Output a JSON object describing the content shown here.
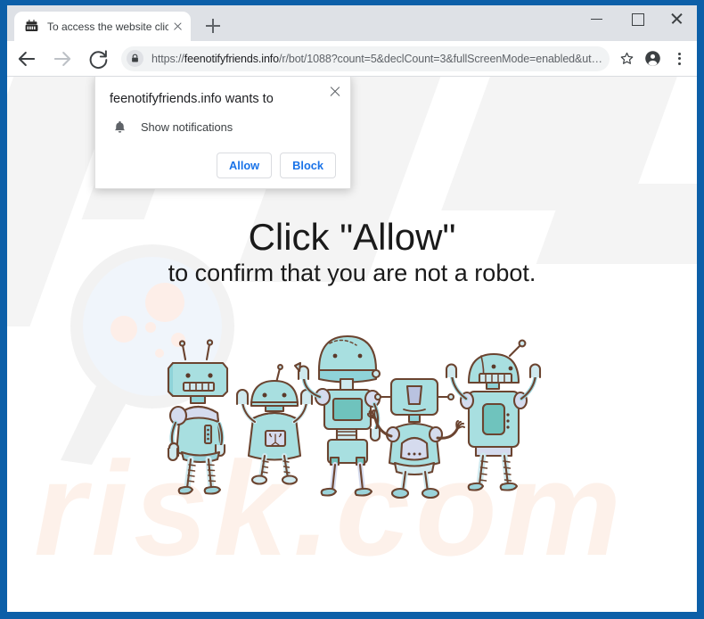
{
  "window": {
    "frame_color": "#0c5fa8",
    "controls": {
      "minimize": "minimize-button",
      "maximize": "maximize-button",
      "close": "close-button"
    }
  },
  "tabstrip": {
    "tab": {
      "title": "To access the website click the \"A",
      "favicon": "robot-head-icon",
      "close_label": "close-tab-icon"
    },
    "new_tab_label": "new-tab-button"
  },
  "toolbar": {
    "back": "back-icon",
    "forward": "forward-icon",
    "reload": "reload-icon",
    "lock": "lock-icon",
    "url_scheme": "https://",
    "url_domain": "feenotifyfriends.info",
    "url_path": "/r/bot/1088?count=5&declCount=3&fullScreenMode=enabled&ut…",
    "bookmark": "star-icon",
    "profile": "profile-avatar-icon",
    "menu": "three-dot-menu-icon"
  },
  "permission_dialog": {
    "title": "feenotifyfriends.info wants to",
    "icon": "bell-icon",
    "request_label": "Show notifications",
    "allow_label": "Allow",
    "block_label": "Block",
    "close_label": "close-dialog-icon",
    "accent_color": "#1a73e8"
  },
  "page": {
    "headline": "Click \"Allow\"",
    "subheadline": "to confirm that you are not a robot.",
    "watermark_text": "risk.com",
    "watermark_glass": "magnifying-glass-watermark",
    "illustration": "five-robots-illustration",
    "robot_body_color": "#a8dfe0",
    "robot_outline_color": "#6b4430",
    "robot_accent_color": "#b9c2e0"
  }
}
